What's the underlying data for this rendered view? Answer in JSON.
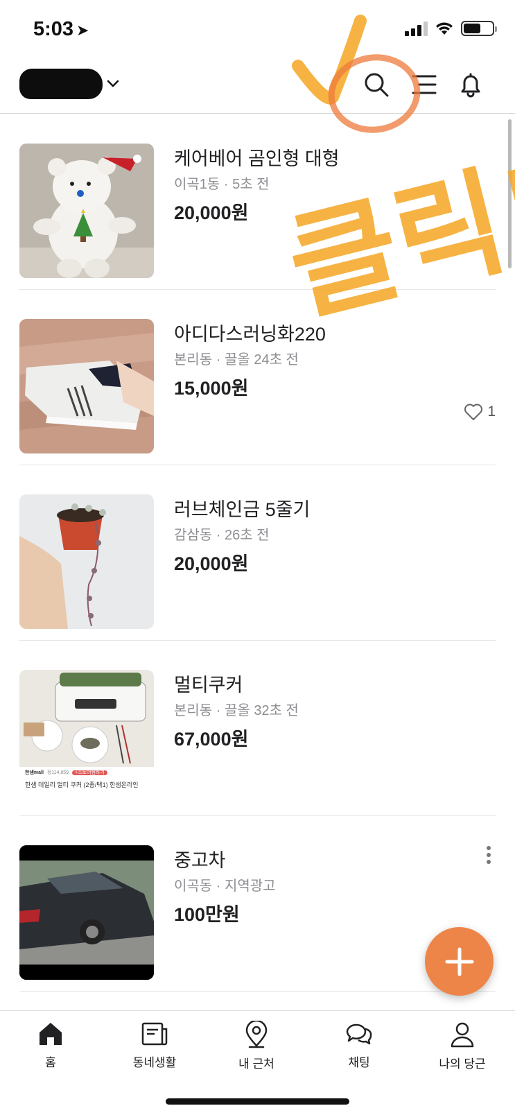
{
  "status_bar": {
    "time": "5:03",
    "signal_bars_on": 3,
    "signal_bars_total": 4,
    "battery_level": 0.6
  },
  "header": {
    "location_label": "",
    "icons": [
      "search-icon",
      "category-menu-icon",
      "bell-icon"
    ]
  },
  "annotation": {
    "text": "클릭!",
    "color": "#f5a623",
    "circle_color": "#ee7a3b"
  },
  "items": [
    {
      "title": "케어베어 곰인형 대형",
      "meta": "이곡1동 · 5초 전",
      "price": "20,000원",
      "likes": "",
      "ad": false,
      "thumb": "teddy-bear"
    },
    {
      "title": "아디다스러닝화220",
      "meta": "본리동 · 끌올 24초 전",
      "price": "15,000원",
      "likes": "1",
      "ad": false,
      "thumb": "sneaker"
    },
    {
      "title": "러브체인금 5줄기",
      "meta": "감삼동 · 26초 전",
      "price": "20,000원",
      "likes": "",
      "ad": false,
      "thumb": "plant"
    },
    {
      "title": "멀티쿠커",
      "meta": "본리동 · 끌올 32초 전",
      "price": "67,000원",
      "likes": "",
      "ad": false,
      "thumb": "multicooker",
      "thumb_caption": "한샘 데일리 멀티 쿠커 (2종/택1) 한샘온라인",
      "thumb_brand": "한샘mall",
      "thumb_price": "정114,859",
      "thumb_tag": "+스토어찜하기"
    },
    {
      "title": "중고차",
      "meta": "이곡동 · 지역광고",
      "price": "100만원",
      "likes": "",
      "ad": true,
      "thumb": "car"
    }
  ],
  "fab": {
    "icon": "plus-icon"
  },
  "tabs": [
    {
      "label": "홈",
      "icon": "home-icon",
      "active": true
    },
    {
      "label": "동네생활",
      "icon": "newspaper-icon",
      "active": false
    },
    {
      "label": "내 근처",
      "icon": "location-pin-icon",
      "active": false
    },
    {
      "label": "채팅",
      "icon": "chat-bubbles-icon",
      "active": false
    },
    {
      "label": "나의 당근",
      "icon": "person-icon",
      "active": false
    }
  ],
  "colors": {
    "accent": "#ee8548",
    "text": "#212124",
    "meta": "#8e8e93",
    "divider": "#e6e6e6"
  }
}
